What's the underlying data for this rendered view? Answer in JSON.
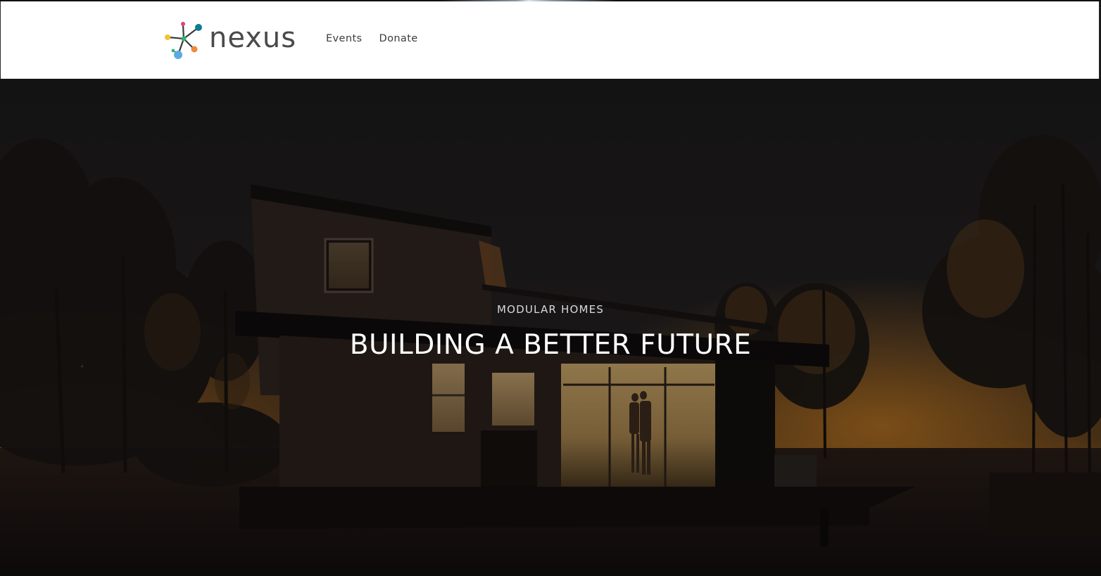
{
  "brand": {
    "name": "nexus",
    "colors": {
      "teal": "#0f7a93",
      "pink": "#e8436f",
      "green": "#2bb573",
      "yellow": "#f2c230",
      "blue": "#5aace0",
      "orange": "#f08a3a"
    }
  },
  "nav": {
    "items": [
      {
        "label": "Events"
      },
      {
        "label": "Donate"
      }
    ]
  },
  "hero": {
    "eyebrow": "MODULAR HOMES",
    "headline": "BUILDING A BETTER FUTURE"
  }
}
